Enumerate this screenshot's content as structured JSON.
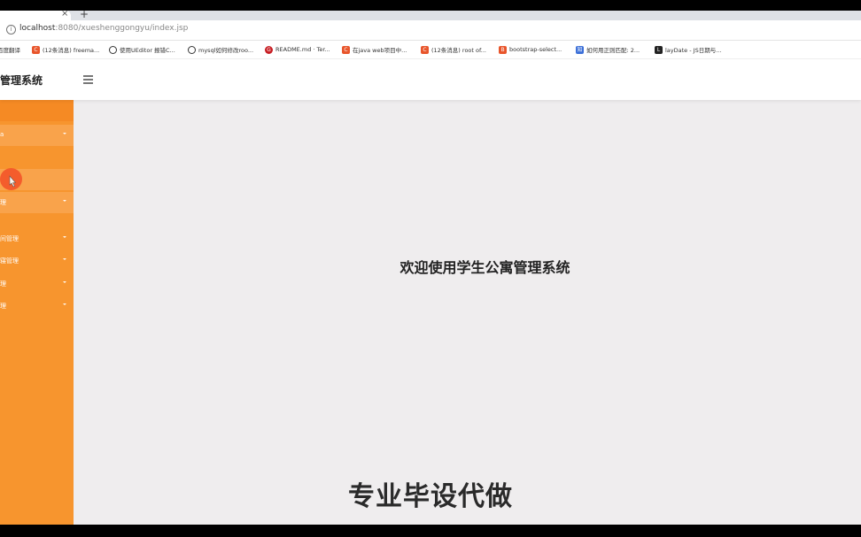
{
  "browser": {
    "tab_close": "×",
    "new_tab": "+",
    "url_host": "localhost",
    "url_rest": ":8080/xueshenggongyu/index.jsp"
  },
  "bookmarks": [
    {
      "label": "百度翻译",
      "icon": "baidu-translate-icon",
      "color": "#3b6fd8"
    },
    {
      "label": "(12条消息) freema...",
      "icon": "csdn-icon",
      "color": "#e8552b"
    },
    {
      "label": "使用UEditor 报错C...",
      "icon": "github-icon",
      "color": "#333333"
    },
    {
      "label": "mysql如何修改roo...",
      "icon": "github-icon",
      "color": "#333333"
    },
    {
      "label": "README.md · Ter...",
      "icon": "gitee-icon",
      "color": "#c71d23"
    },
    {
      "label": "在java web项目中...",
      "icon": "csdn-icon",
      "color": "#e8552b"
    },
    {
      "label": "(12条消息) root of...",
      "icon": "csdn-icon",
      "color": "#e8552b"
    },
    {
      "label": "bootstrap-select...",
      "icon": "bootstrap-icon",
      "color": "#e8552b"
    },
    {
      "label": "如何用正则匹配: 2...",
      "icon": "zhihu-icon",
      "color": "#3b6fd8"
    },
    {
      "label": "layDate - JS日期与...",
      "icon": "layui-icon",
      "color": "#222222"
    }
  ],
  "header": {
    "title": "管理系统"
  },
  "sidebar": {
    "items": [
      {
        "label": "a",
        "caret": true,
        "highlight": true
      },
      {
        "label": "",
        "caret": false,
        "highlight": false
      },
      {
        "label": "",
        "caret": false,
        "highlight": true
      },
      {
        "label": "理",
        "caret": true,
        "highlight": true
      },
      {
        "label": "",
        "caret": false,
        "highlight": false
      },
      {
        "label": "间管理",
        "caret": true,
        "highlight": false
      },
      {
        "label": "寝管理",
        "caret": true,
        "highlight": false
      },
      {
        "label": "理",
        "caret": true,
        "highlight": false
      },
      {
        "label": "理",
        "caret": true,
        "highlight": false
      }
    ]
  },
  "main": {
    "welcome": "欢迎使用学生公寓管理系统"
  },
  "overlay": {
    "watermark": "专业毕设代做"
  }
}
